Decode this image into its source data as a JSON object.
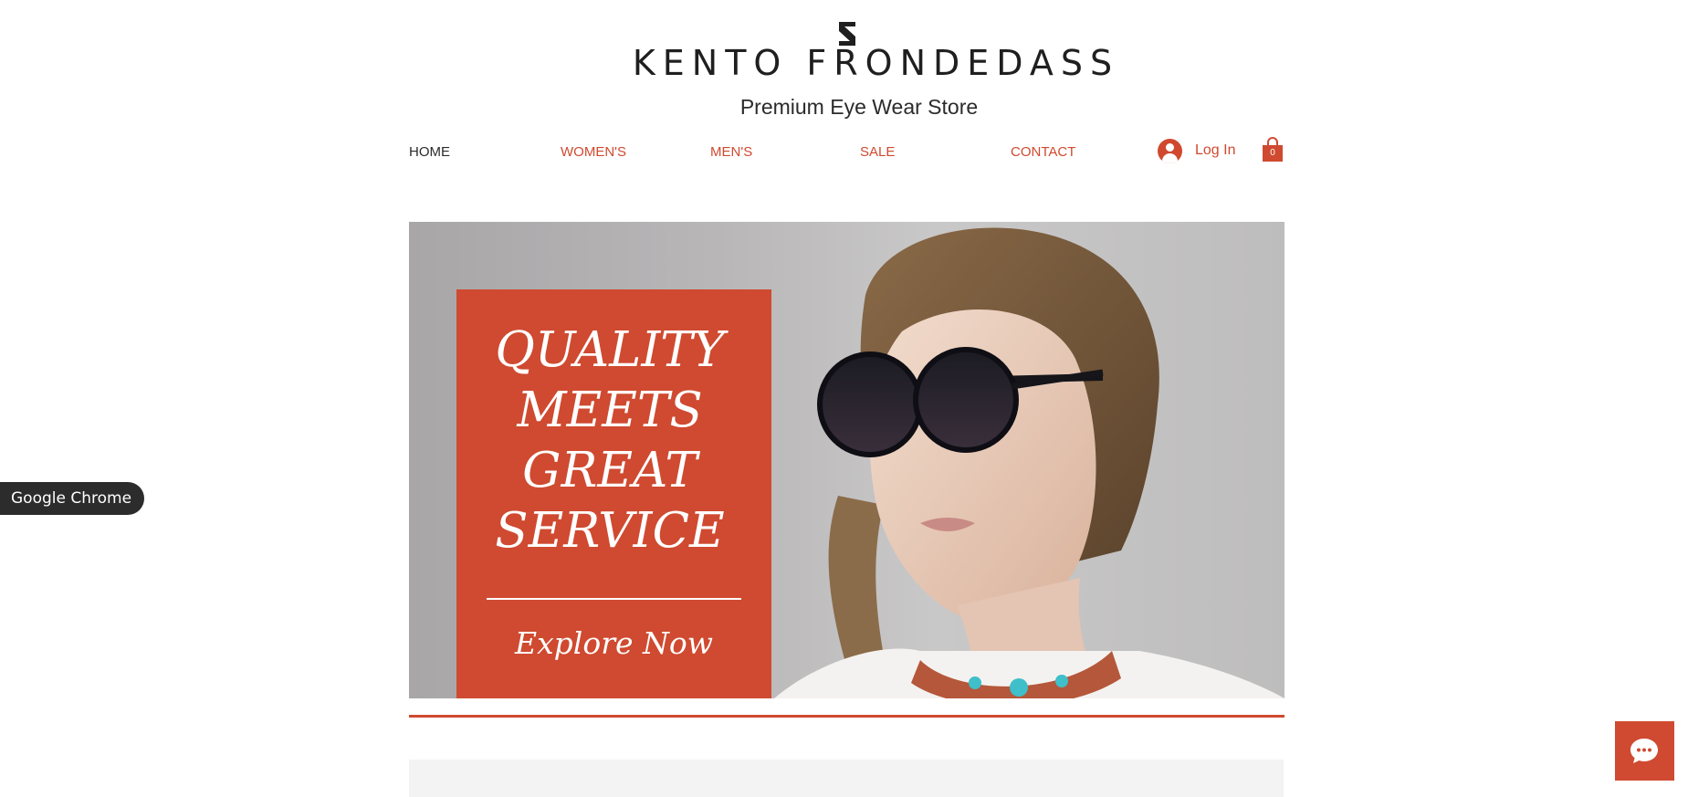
{
  "header": {
    "brand_name": "KENTO FRONDEDASS",
    "tagline": "Premium Eye Wear Store",
    "logo_icon": "s-monogram-icon"
  },
  "nav": {
    "items": [
      {
        "label": "HOME",
        "active": true
      },
      {
        "label": "WOMEN'S",
        "active": false
      },
      {
        "label": "MEN'S",
        "active": false
      },
      {
        "label": "SALE",
        "active": false
      },
      {
        "label": "CONTACT",
        "active": false
      }
    ],
    "login_label": "Log In",
    "login_icon": "user-avatar-icon",
    "cart_count": "0",
    "cart_icon": "shopping-bag-icon"
  },
  "hero": {
    "title": "QUALITY\nMEETS\nGREAT\nSERVICE",
    "cta_label": "Explore Now",
    "image": "model-in-round-sunglasses-photo"
  },
  "overlay": {
    "chrome_badge": "Google Chrome",
    "chat_icon": "chat-bubble-icon"
  },
  "colors": {
    "accent": "#cf4a30",
    "text_dark": "#2b2b2b",
    "hero_background": "#b8b6b7",
    "strip_background": "#f3f3f3"
  }
}
